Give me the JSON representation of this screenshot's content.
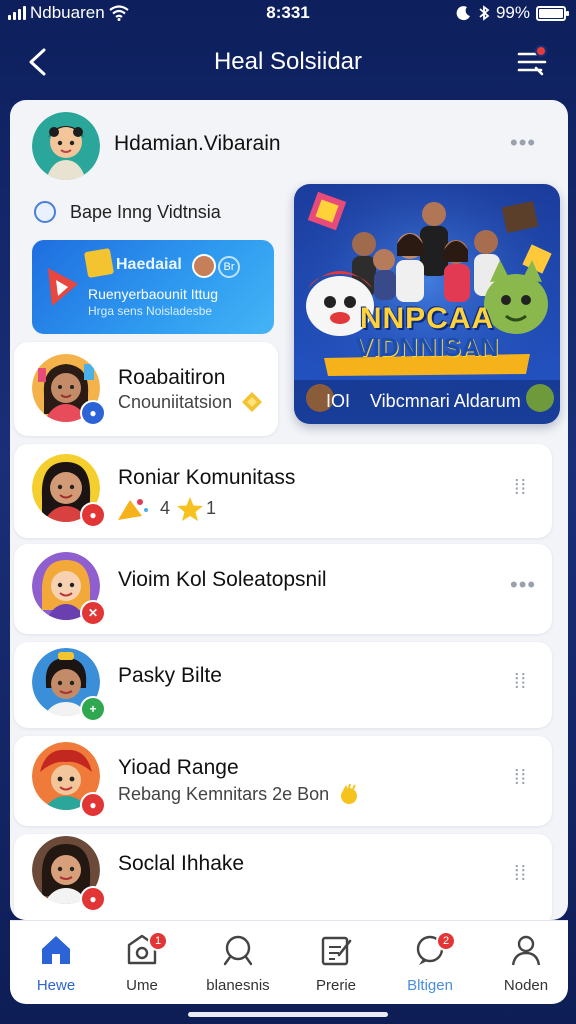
{
  "status_bar": {
    "carrier": "Ndbuaren",
    "time": "8:331",
    "battery": "99%",
    "battery_level": 0.99
  },
  "header": {
    "title": "Heal Solsiidar",
    "back_icon": "chevron-left-icon",
    "menu_icon": "menu-icon"
  },
  "post": {
    "author": "Hdamian.Vibarain",
    "tag": "Bape Inng Vidtnsia",
    "promo": {
      "title": "Haedaial",
      "badge": "Br",
      "line1": "Ruenyerbaounit Ittug",
      "line2": "Hrga sens Noisladesbe"
    },
    "feature": {
      "title_line1": "NNPCAA",
      "title_line2": "VIDNNISAN",
      "caption_left": "IOI",
      "caption_right": "Vibcmnari Aldarum"
    }
  },
  "rows": [
    {
      "name": "Roabaitiron",
      "sub": "Cnouniitatsion"
    },
    {
      "name": "Roniar Komunitass",
      "sub": "4",
      "sub2": "1"
    },
    {
      "name": "Vioim Kol Soleatopsnil",
      "sub": ""
    },
    {
      "name": "Pasky Bilte",
      "sub": ""
    },
    {
      "name": "Yioad Range",
      "sub": "Rebang Kemnitars 2e Bon"
    },
    {
      "name": "Soclal Ihhake",
      "sub": ""
    }
  ],
  "nav": [
    {
      "label": "Hewe",
      "icon": "home-icon",
      "active": true,
      "badge": ""
    },
    {
      "label": "Ume",
      "icon": "camera-icon",
      "active": false,
      "badge": "1"
    },
    {
      "label": "blanesnis",
      "icon": "search-icon",
      "active": false,
      "badge": ""
    },
    {
      "label": "Prerie",
      "icon": "compose-icon",
      "active": false,
      "badge": ""
    },
    {
      "label": "Bltigen",
      "icon": "chat-icon",
      "active": false,
      "badge": "2"
    },
    {
      "label": "Noden",
      "icon": "profile-icon",
      "active": false,
      "badge": ""
    }
  ],
  "colors": {
    "accent": "#2c63d6",
    "badge": "#e23535",
    "background": "#14286b"
  }
}
